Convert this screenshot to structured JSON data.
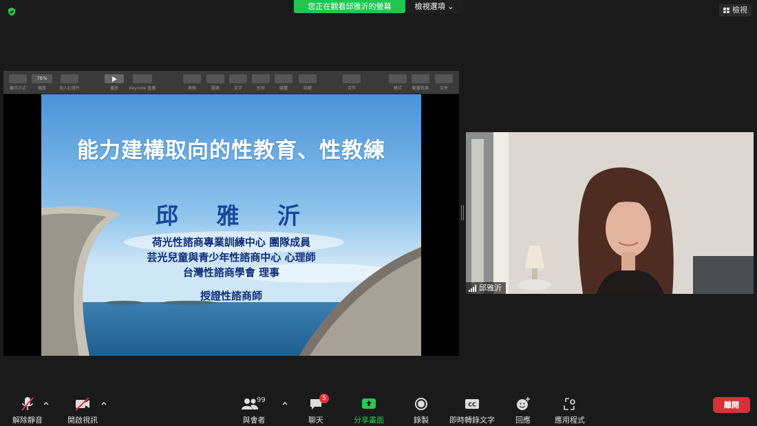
{
  "banner": {
    "sharing_text": "您正在觀看邱雅沂的螢幕",
    "view_options": "檢視選項"
  },
  "view_button": "檢視",
  "keynote_toolbar": {
    "zoom": "76%",
    "items": [
      "顯示方式",
      "縮放",
      "加入幻燈片",
      "播放",
      "Keynote 直播",
      "表格",
      "圖表",
      "文字",
      "形狀",
      "媒體",
      "註解",
      "合作",
      "格式",
      "動畫效果",
      "文件"
    ]
  },
  "slide": {
    "title": "能力建構取向的性教育、性教練",
    "presenter_name": "邱 雅 沂",
    "lines": [
      "荷光性諮商專業訓練中心  團隊成員",
      "芸光兒童與青少年性諮商中心  心理師",
      "台灣性諮商學會    理事",
      "授證性諮商師"
    ]
  },
  "participant": {
    "name": "邱雅沂"
  },
  "controls": {
    "unmute": "解除靜音",
    "start_video": "開啟視訊",
    "participants": "與會者",
    "participants_count": "99",
    "chat": "聊天",
    "chat_badge": "5",
    "share_screen": "分享畫面",
    "record": "錄製",
    "live_transcript": "即時轉錄文字",
    "reactions": "回應",
    "apps": "應用程式",
    "leave": "離開"
  },
  "colors": {
    "share_green": "#23c552",
    "leave_red": "#d6323a"
  }
}
